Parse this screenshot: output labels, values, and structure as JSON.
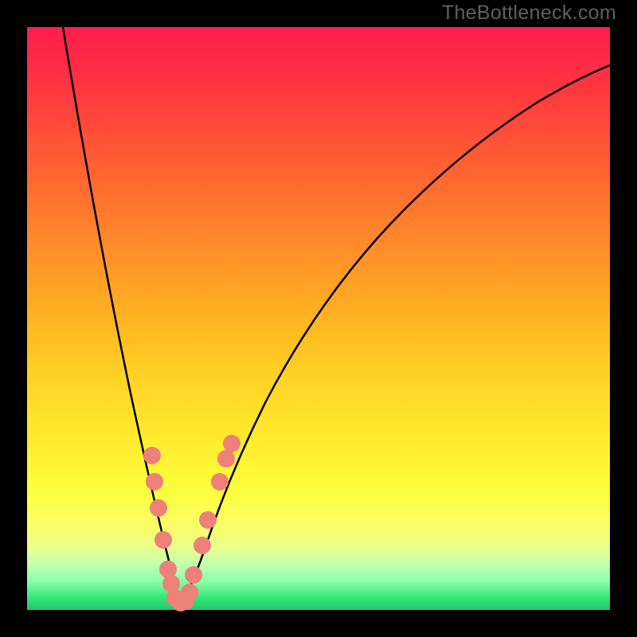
{
  "watermark": "TheBottleneck.com",
  "colors": {
    "dot": "#ed8079",
    "curve": "#000000",
    "frame": "#000000"
  },
  "chart_data": {
    "type": "line",
    "title": "",
    "xlabel": "",
    "ylabel": "",
    "xlim": [
      0,
      100
    ],
    "ylim": [
      0,
      100
    ],
    "series": [
      {
        "name": "bottleneck-curve",
        "x": [
          6,
          8,
          10,
          12,
          14,
          16,
          18,
          20,
          22,
          23,
          24,
          25,
          26,
          27,
          28,
          29,
          31,
          33,
          35,
          38,
          42,
          48,
          55,
          63,
          72,
          82,
          92,
          100
        ],
        "y": [
          100,
          92,
          83,
          73,
          63,
          53,
          43,
          33,
          20,
          13,
          8,
          3,
          1,
          1,
          2,
          5,
          12,
          20,
          27,
          35,
          45,
          55,
          64,
          72,
          79,
          85,
          90,
          93
        ]
      }
    ],
    "marker_points": {
      "name": "salmon-dots",
      "x_percent": [
        21.4,
        21.9,
        22.5,
        23.4,
        24.2,
        24.7,
        25.4,
        26.4,
        27.2,
        27.9,
        28.5,
        30.0,
        31.0,
        33.0,
        34.2,
        35.1
      ],
      "y_percent": [
        26.5,
        22.0,
        17.5,
        12.0,
        7.0,
        4.5,
        2.0,
        1.2,
        1.5,
        3.0,
        6.0,
        11.0,
        15.5,
        22.0,
        26.0,
        28.5
      ]
    }
  }
}
